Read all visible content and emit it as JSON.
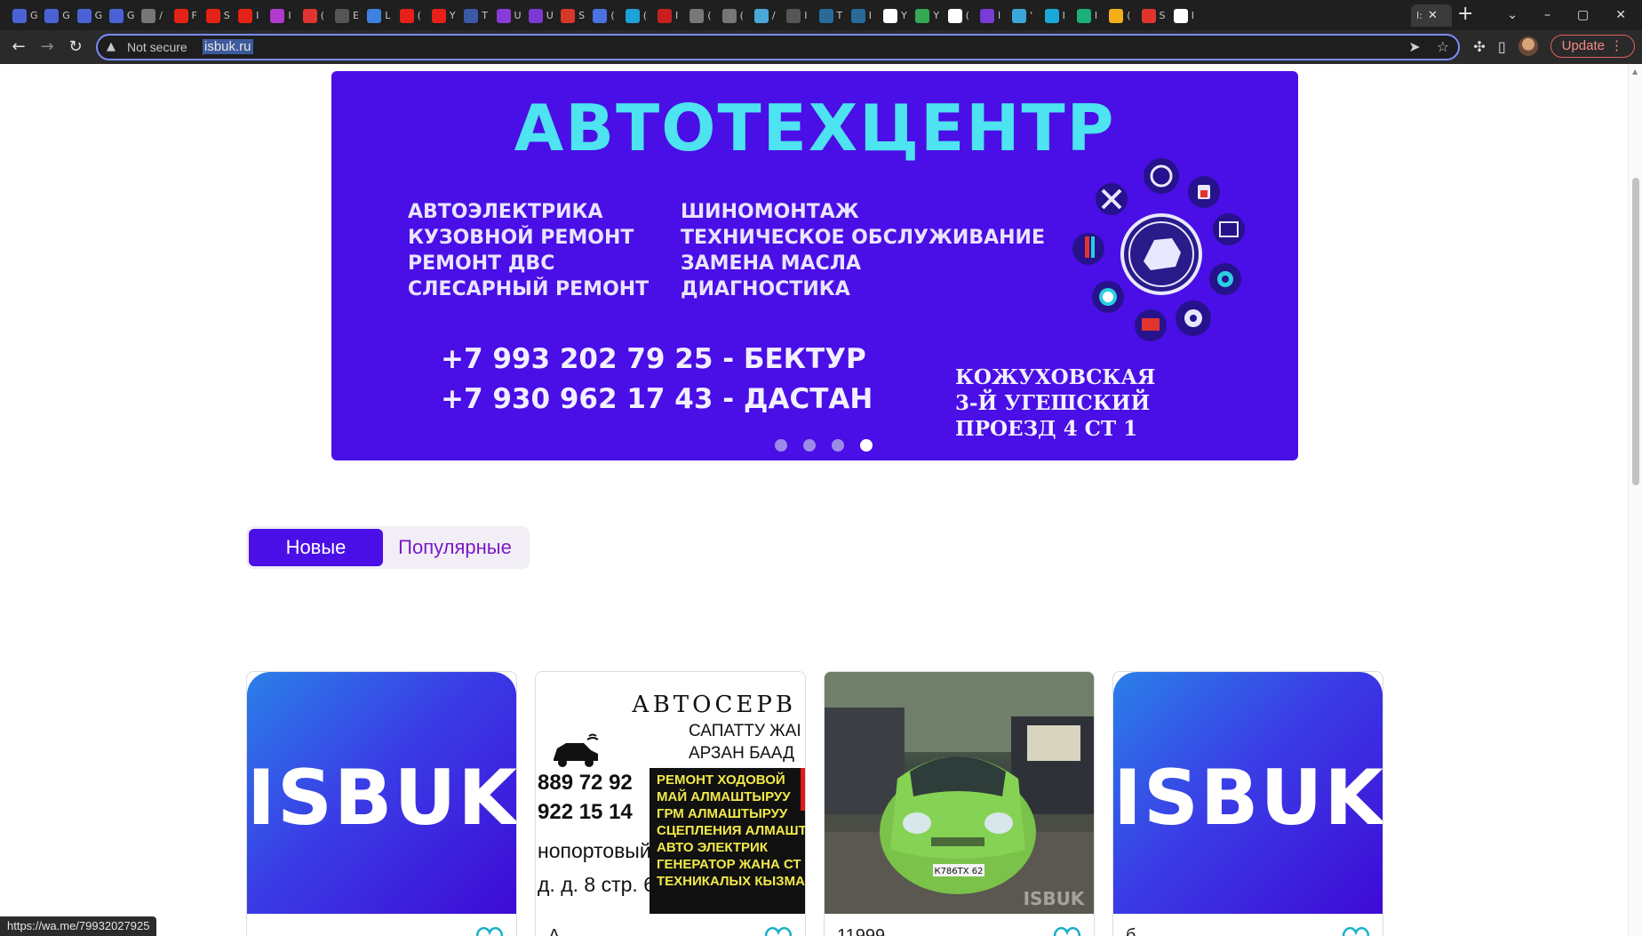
{
  "browser": {
    "tabs": [
      {
        "label": "G",
        "color": "#4a62d8"
      },
      {
        "label": "G",
        "color": "#4a62d8"
      },
      {
        "label": "G",
        "color": "#4a62d8"
      },
      {
        "label": "G",
        "color": "#4a62d8"
      },
      {
        "label": "/",
        "color": "#777777"
      },
      {
        "label": "F",
        "color": "#e62117"
      },
      {
        "label": "S",
        "color": "#e62117"
      },
      {
        "label": "I",
        "color": "#e62117"
      },
      {
        "label": "I",
        "color": "#b03ad0"
      },
      {
        "label": "(",
        "color": "#e0352f"
      },
      {
        "label": "E",
        "color": "#555555"
      },
      {
        "label": "L",
        "color": "#3c82e0"
      },
      {
        "label": "(",
        "color": "#e62117"
      },
      {
        "label": "Y",
        "color": "#e62117"
      },
      {
        "label": "T",
        "color": "#3a5aa8"
      },
      {
        "label": "U",
        "color": "#8a3ad8"
      },
      {
        "label": "U",
        "color": "#7a3ad0"
      },
      {
        "label": "S",
        "color": "#d8382a"
      },
      {
        "label": "(",
        "color": "#4a72e0"
      },
      {
        "label": "(",
        "color": "#1da2d8"
      },
      {
        "label": "I",
        "color": "#c82020"
      },
      {
        "label": "(",
        "color": "#777777"
      },
      {
        "label": "(",
        "color": "#777777"
      },
      {
        "label": "/",
        "color": "#4aa8d8"
      },
      {
        "label": "I",
        "color": "#555555"
      },
      {
        "label": "T",
        "color": "#2a6a9a"
      },
      {
        "label": "I",
        "color": "#2a6a9a"
      },
      {
        "label": "Y",
        "color": "#ffffff"
      },
      {
        "label": "Y",
        "color": "#34a853"
      },
      {
        "label": "(",
        "color": "#ffffff"
      },
      {
        "label": "I",
        "color": "#7a3ad8"
      },
      {
        "label": "'",
        "color": "#3aa8d8"
      },
      {
        "label": "I",
        "color": "#1aa8d8"
      },
      {
        "label": "I",
        "color": "#1ab07a"
      },
      {
        "label": "(",
        "color": "#f2b01a"
      },
      {
        "label": "S",
        "color": "#e0352f"
      },
      {
        "label": "I",
        "color": "#ffffff"
      }
    ],
    "active_tab": {
      "label": "I:",
      "close": "✕"
    },
    "new_tab": "+",
    "window_controls": {
      "dropdown": "⌄",
      "minimize": "–",
      "maximize": "▢",
      "close": "✕"
    },
    "nav": {
      "back": "←",
      "forward": "→",
      "reload": "↻"
    },
    "address": {
      "security_label": "Not secure",
      "url": "isbuk.ru"
    },
    "toolbar": {
      "update_label": "Update",
      "menu": "⋮"
    }
  },
  "banner": {
    "title": "АВТОТЕХЦЕНТР",
    "services_left": [
      "АВТОЭЛЕКТРИКА",
      "КУЗОВНОЙ РЕМОНТ",
      "РЕМОНТ ДВС",
      "СЛЕСАРНЫЙ РЕМОНТ"
    ],
    "services_right": [
      "ШИНОМОНТАЖ",
      "ТЕХНИЧЕСКОЕ ОБСЛУЖИВАНИЕ",
      "ЗАМЕНА МАСЛА",
      "ДИАГНОСТИКА"
    ],
    "phones": [
      "+7 993 202 79 25 - БЕКТУР",
      "+7 930 962 17 43 - ДАСТАН"
    ],
    "address": [
      "КОЖУХОВСКАЯ",
      "3-Й УГЕШСКИЙ",
      "ПРОЕЗД 4 СТ 1"
    ],
    "slides_total": 4,
    "active_slide": 4,
    "bg_color": "#4a0ee6",
    "title_color": "#4de3f0"
  },
  "filters": {
    "new_label": "Новые",
    "popular_label": "Популярные",
    "active": "new",
    "accent": "#4a0ee6",
    "inactive_color": "#7a19c9"
  },
  "listings": [
    {
      "image": "isbuk-logo",
      "logo_text": "ISBUK",
      "title": ""
    },
    {
      "image": "autoservice-sign",
      "sign": {
        "heading": "АВТОСЕРВ",
        "lines": [
          "САПАТТУ ЖАІ",
          "АРЗАН БААД"
        ],
        "numbers": [
          "889 72 92",
          "922 15 14"
        ],
        "address": [
          "нопортовый",
          "д. д. 8 стр. 6"
        ],
        "services": [
          "РЕМОНТ ХОДОВОЙ",
          "МАЙ АЛМАШТЫРУУ",
          "ГРМ АЛМАШТЫРУУ",
          "СЦЕПЛЕНИЯ АЛМАШТ",
          "АВТО ЭЛЕКТРИК",
          "ГЕНЕРАТОР ЖАНА СТ",
          "ТЕХНИКАЛЫХ КЫЗМА"
        ]
      },
      "title": "А"
    },
    {
      "image": "car-photo",
      "plate": "К786ТХ 62",
      "watermark": "ISBUK",
      "title": "11999"
    },
    {
      "image": "isbuk-logo",
      "logo_text": "ISBUK",
      "title": "б"
    }
  ],
  "heart_icon_color": "#1ab0c8",
  "status_url": "https://wa.me/79932027925"
}
